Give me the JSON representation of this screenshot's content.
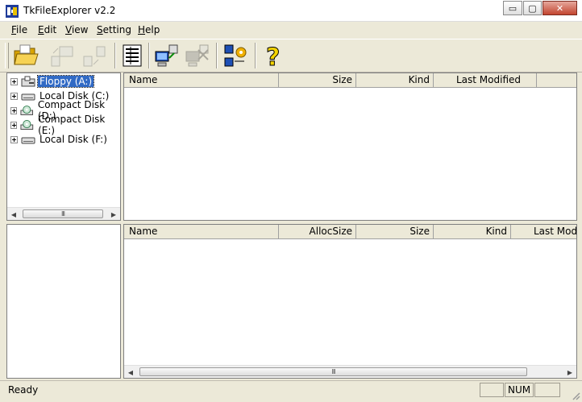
{
  "window": {
    "title": "TkFileExplorer v2.2",
    "controls": {
      "minimize": "▭",
      "maximize": "▢",
      "close": "✕"
    }
  },
  "menu": [
    {
      "label": "File",
      "access": "F",
      "rest": "ile"
    },
    {
      "label": "Edit",
      "access": "E",
      "rest": "dit"
    },
    {
      "label": "View",
      "access": "V",
      "rest": "iew"
    },
    {
      "label": "Setting",
      "access": "S",
      "rest": "etting"
    },
    {
      "label": "Help",
      "access": "H",
      "rest": "elp"
    }
  ],
  "toolbar": {
    "buttons": [
      {
        "name": "open-folder",
        "icon": "open-folder-icon",
        "enabled": true
      },
      {
        "name": "copy",
        "icon": "copy-computer-icon",
        "enabled": false
      },
      {
        "name": "move",
        "icon": "move-files-icon",
        "enabled": false
      },
      {
        "name": "details-view",
        "icon": "details-view-icon",
        "enabled": true
      },
      {
        "name": "map-network-drive",
        "icon": "network-connect-icon",
        "enabled": true
      },
      {
        "name": "disconnect-network-drive",
        "icon": "network-disconnect-icon",
        "enabled": false
      },
      {
        "name": "settings",
        "icon": "network-settings-icon",
        "enabled": true
      },
      {
        "name": "help",
        "icon": "question-mark-icon",
        "enabled": true
      }
    ]
  },
  "tree": {
    "items": [
      {
        "label": "Floppy (A:)",
        "icon": "floppy-drive-icon",
        "selected": true
      },
      {
        "label": "Local Disk (C:)",
        "icon": "hard-disk-icon",
        "selected": false
      },
      {
        "label": "Compact Disk (D:)",
        "icon": "cd-drive-icon",
        "selected": false
      },
      {
        "label": "Compact Disk (E:)",
        "icon": "cd-drive-icon",
        "selected": false
      },
      {
        "label": "Local Disk (F:)",
        "icon": "hard-disk-icon",
        "selected": false
      }
    ]
  },
  "file_list": {
    "columns": [
      "Name",
      "Size",
      "Kind",
      "Last Modified"
    ],
    "rows": []
  },
  "detail_list": {
    "columns": [
      "Name",
      "AllocSize",
      "Size",
      "Kind",
      "Last Modified"
    ],
    "rows": []
  },
  "scrollbar": {
    "grip": "III",
    "left_arrow": "◀",
    "right_arrow": "▶"
  },
  "statusbar": {
    "text": "Ready",
    "num": "NUM"
  },
  "colors": {
    "selection": "#316ac5",
    "chrome": "#ece9d8",
    "help_icon": "#f4d400"
  }
}
